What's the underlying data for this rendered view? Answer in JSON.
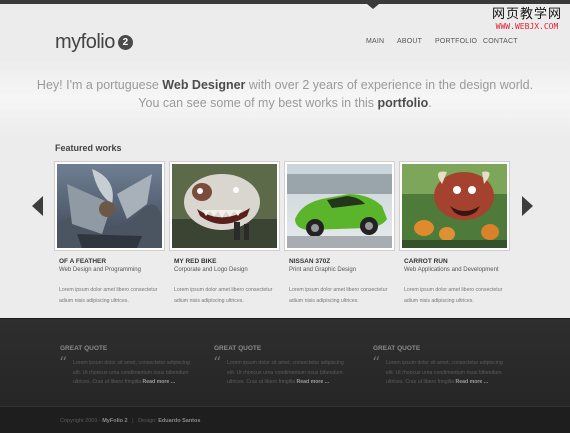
{
  "watermark": {
    "title": "网页教学网",
    "url": "WWW.WEBJX.COM"
  },
  "logo": {
    "text": "myfolio",
    "badge": "2"
  },
  "nav": {
    "items": [
      "MAIN",
      "ABOUT",
      "PORTFOLIO",
      "CONTACT"
    ]
  },
  "hero": {
    "line1_a": "Hey! I'm a portuguese ",
    "line1_b": "Web Designer",
    "line1_c": " with over 2 years of experience in the design world.",
    "line2_a": "You can see some of my best works in this ",
    "line2_b": "portfolio",
    "line2_c": "."
  },
  "featured": {
    "title": "Featured works",
    "works": [
      {
        "title": "OF A FEATHER",
        "subtitle": "Web Design and Programming",
        "desc": "Lorem ipsum dolor amet libero consectetur adium nisis adipiscing ultrices."
      },
      {
        "title": "MY RED BIKE",
        "subtitle": "Corporate and Logo Design",
        "desc": "Lorem ipsum dolor amet libero consectetur adium nisis adipiscing ultrices."
      },
      {
        "title": "NISSAN 370Z",
        "subtitle": "Print and Graphic Design",
        "desc": "Lorem ipsum dolor amet libero consectetur adium nisis adipiscing ultrices."
      },
      {
        "title": "CARROT RUN",
        "subtitle": "Web Applications and Development",
        "desc": "Lorem ipsum dolor amet libero consectetur adium nisis adipiscing ultrices."
      }
    ]
  },
  "quotes": {
    "items": [
      {
        "title": "GREAT QUOTE",
        "text": "Lorem ipsum dolor sit amet, consectetur adipiscing elit. Ut rhoncus urna condimentum risus bibendum ultrices. Cras ut libero fringilla",
        "readmore": "Read more ..."
      },
      {
        "title": "GREAT QUOTE",
        "text": "Lorem ipsum dolor sit amet, consectetur adipiscing elit. Ut rhoncus urna condimentum risus bibendum ultrices. Cras ut libero fringilla",
        "readmore": "Read more ..."
      },
      {
        "title": "GREAT QUOTE",
        "text": "Lorem ipsum dolor sit amet, consectetur adipiscing elit. Ut rhoncus urna condimentum risus bibendum ultrices. Cras ut libero fringilla",
        "readmore": "Read more ..."
      }
    ]
  },
  "footer": {
    "copyright": "Copyright 2009 -",
    "site": "MyFolio 2",
    "design_label": "Design:",
    "designer": "Eduardo Santos"
  }
}
